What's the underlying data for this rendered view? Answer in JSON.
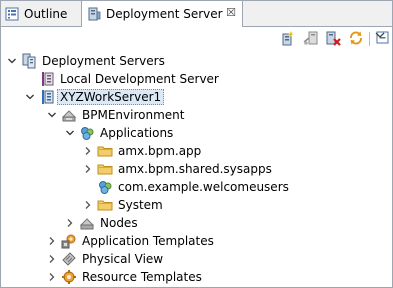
{
  "tabs": {
    "outline_label": "Outline",
    "deployment_label": "Deployment Server",
    "close_glyph": "☒"
  },
  "toolbar": {
    "icons": [
      "new-server-icon",
      "connect-icon",
      "delete-server-icon",
      "refresh-icon",
      "collapse-all-icon",
      "view-menu-icon"
    ]
  },
  "tree": {
    "root": "Deployment Servers",
    "local_server": "Local Development Server",
    "work_server": "XYZWorkServer1",
    "bpm_env": "BPMEnvironment",
    "applications": "Applications",
    "app1": "amx.bpm.app",
    "app2": "amx.bpm.shared.sysapps",
    "app3": "com.example.welcomeusers",
    "app4": "System",
    "nodes": "Nodes",
    "app_templates": "Application Templates",
    "physical_view": "Physical View",
    "resource_templates": "Resource Templates"
  },
  "colors": {
    "selection_bg": "#dbe9f7",
    "folder": "#e8b84a",
    "border": "#9ea7b1"
  }
}
